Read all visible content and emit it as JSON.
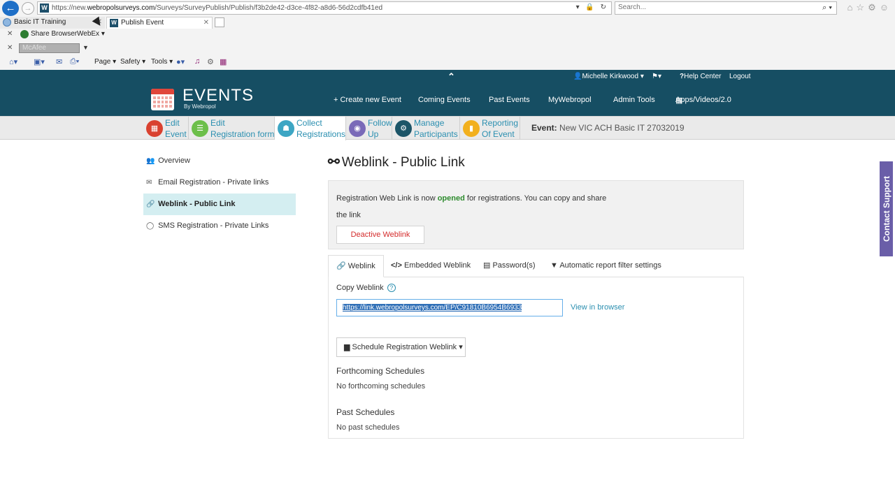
{
  "browser": {
    "url_prefix": "https://new.",
    "url_domain": "webropolsurveys.com",
    "url_rest": "/Surveys/SurveyPublish/Publish/f3b2de42-d3ce-4f82-a8d6-56d2cdfb41ed",
    "search_placeholder": "Search...",
    "tabs": [
      {
        "label": "Basic IT Training"
      },
      {
        "label": "Publish Event"
      }
    ],
    "favorites": {
      "share_browser": "Share Browser",
      "webex": "WebEx"
    },
    "mcafee": "McAfee",
    "menus": {
      "page": "Page ▾",
      "safety": "Safety ▾",
      "tools": "Tools ▾"
    }
  },
  "header": {
    "logo_title": "EVENTS",
    "logo_subtitle": "By Webropol",
    "user": "Michelle Kirkwood ▾",
    "flag_menu": "▾",
    "help": "Help Center",
    "logout": "Logout",
    "nav": [
      "+ Create new Event",
      "Coming Events",
      "Past Events",
      "MyWebropol",
      "Admin Tools",
      "Apps/Videos/2.0"
    ]
  },
  "steps": [
    {
      "line1": "Edit",
      "line2": "Event",
      "color": "#d9412f"
    },
    {
      "line1": "Edit",
      "line2": "Registration form",
      "color": "#6cbf4a"
    },
    {
      "line1": "Collect",
      "line2": "Registrations",
      "color": "#3da6c4"
    },
    {
      "line1": "Follow",
      "line2": "Up",
      "color": "#7a6ab8"
    },
    {
      "line1": "Manage",
      "line2": "Participants",
      "color": "#1c5568"
    },
    {
      "line1": "Reporting",
      "line2": "Of Event",
      "color": "#f2b01e"
    }
  ],
  "event": {
    "label": "Event:",
    "name": "New VIC ACH Basic IT 27032019"
  },
  "left_nav": [
    {
      "label": "Overview"
    },
    {
      "label": "Email Registration - Private links"
    },
    {
      "label": "Weblink - Public Link"
    },
    {
      "label": "SMS Registration - Private Links"
    }
  ],
  "main": {
    "title": "Weblink - Public Link",
    "info_pre": "Registration Web Link is now ",
    "info_status": "opened",
    "info_post": " for registrations. You can copy and share the link",
    "deactivate_label": "Deactive Weblink",
    "tabs": [
      {
        "label": "Weblink"
      },
      {
        "label": "Embedded Weblink"
      },
      {
        "label": "Password(s)"
      },
      {
        "label": "Automatic report filter settings"
      }
    ],
    "copy_label": "Copy Weblink",
    "weblink_url": "https://link.webropolsurveys.com/EP/C91810B6954B6933",
    "view_in_browser": "View in browser",
    "schedule_label": "Schedule Registration Weblink ▾",
    "forthcoming_head": "Forthcoming Schedules",
    "forthcoming_body": "No forthcoming schedules",
    "past_head": "Past Schedules",
    "past_body": "No past schedules"
  },
  "contact_support": "Contact Support"
}
